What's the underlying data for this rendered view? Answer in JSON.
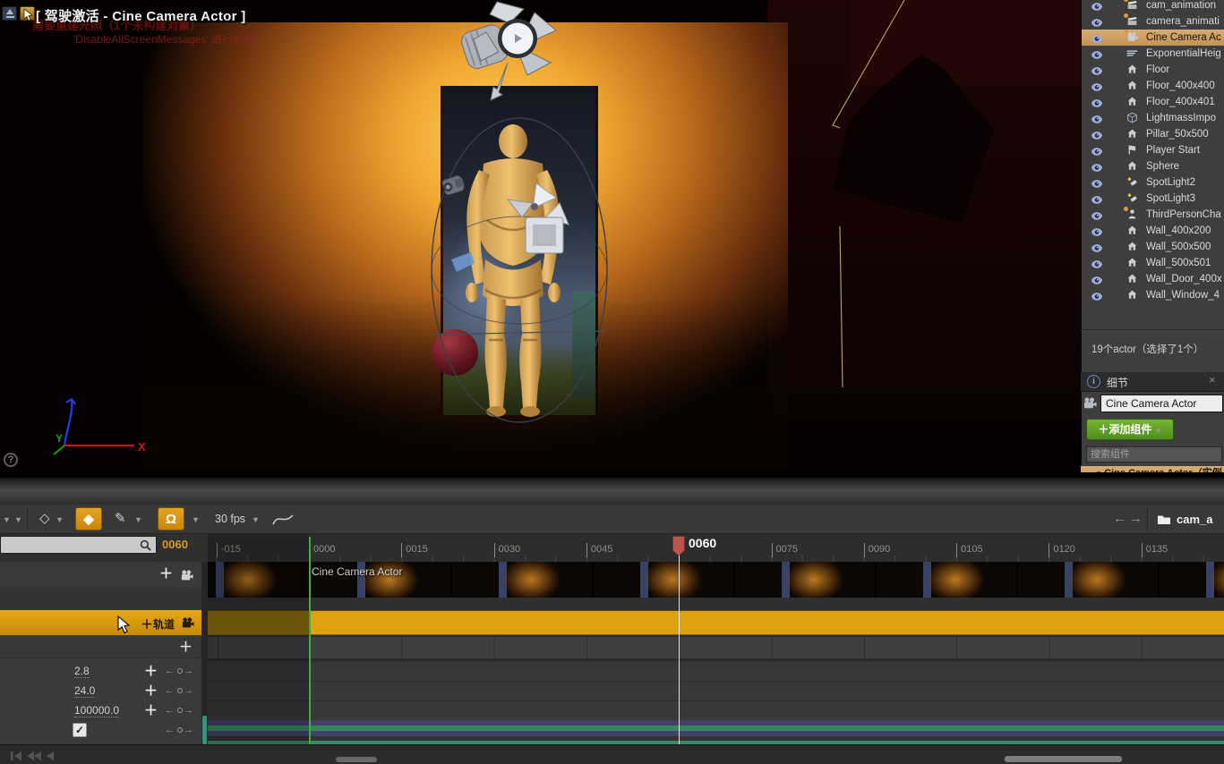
{
  "colors": {
    "accent_orange": "#d8930f",
    "track_yellow": "#dfa112",
    "selection_tan": "#c9a06b",
    "add_component_green": "#5f9b22",
    "playhead_red": "#bf544f"
  },
  "viewport": {
    "title": "[ 驾驶激活 - Cine Camera Actor ]",
    "warning_line1": "需要重建光照（1个未构建对象）",
    "warning_line2": "'DisableAllScreenMessages' 进行抑制",
    "axis_x_label": "X",
    "axis_y_label": "Y",
    "help_label": "?"
  },
  "outliner": {
    "items": [
      {
        "label": "cam_animation",
        "icon": "clapper",
        "dot": "#e09a3a"
      },
      {
        "label": "camera_animati",
        "icon": "clapper",
        "dot": "#e09a3a"
      },
      {
        "label": "Cine Camera Ac",
        "icon": "camera",
        "dot": "#e09a3a",
        "selected": true
      },
      {
        "label": "ExponentialHeig",
        "icon": "fog"
      },
      {
        "label": "Floor",
        "icon": "house"
      },
      {
        "label": "Floor_400x400",
        "icon": "house"
      },
      {
        "label": "Floor_400x401",
        "icon": "house"
      },
      {
        "label": "LightmassImpo",
        "icon": "volume"
      },
      {
        "label": "Pillar_50x500",
        "icon": "house"
      },
      {
        "label": "Player Start",
        "icon": "player"
      },
      {
        "label": "Sphere",
        "icon": "house"
      },
      {
        "label": "SpotLight2",
        "icon": "spotlight"
      },
      {
        "label": "SpotLight3",
        "icon": "spotlight"
      },
      {
        "label": "ThirdPersonCha",
        "icon": "person",
        "dot": "#e09a3a"
      },
      {
        "label": "Wall_400x200",
        "icon": "house"
      },
      {
        "label": "Wall_500x500",
        "icon": "house"
      },
      {
        "label": "Wall_500x501",
        "icon": "house"
      },
      {
        "label": "Wall_Door_400x",
        "icon": "house"
      },
      {
        "label": "Wall_Window_4",
        "icon": "house"
      }
    ],
    "status": "19个actor（选择了1个）"
  },
  "details": {
    "tab": "细节",
    "tab_icon": "i",
    "close": "×",
    "actor_name": "Cine Camera Actor",
    "add_component": "添加组件",
    "search_placeholder": "搜索组件",
    "instance_row": "Cine Camera Actor（实例"
  },
  "sequencer": {
    "fps": "30 fps",
    "breadcrumb": "cam_a",
    "frame_field": "0060",
    "playhead_label": "0060",
    "camera_track_label": "Cine Camera Actor",
    "add_track_label": "轨道",
    "ticks": [
      {
        "label": "-015",
        "frame": -15
      },
      {
        "label": "0000",
        "frame": 0
      },
      {
        "label": "0015",
        "frame": 15
      },
      {
        "label": "0030",
        "frame": 30
      },
      {
        "label": "0045",
        "frame": 45
      },
      {
        "label": "0075",
        "frame": 75
      },
      {
        "label": "0090",
        "frame": 90
      },
      {
        "label": "0105",
        "frame": 105
      },
      {
        "label": "0120",
        "frame": 120
      },
      {
        "label": "0135",
        "frame": 135
      }
    ],
    "value_rows": [
      {
        "value": "2.8"
      },
      {
        "value": "24.0"
      },
      {
        "value": "100000.0"
      }
    ],
    "checkbox_checked": true
  }
}
